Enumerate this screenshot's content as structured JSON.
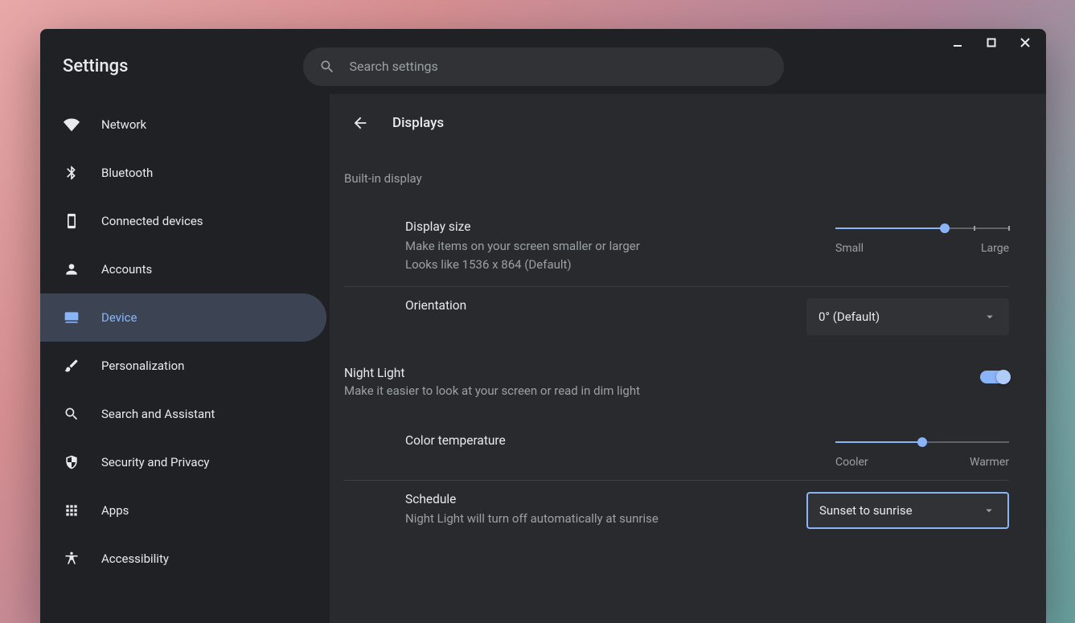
{
  "header": {
    "title": "Settings"
  },
  "search": {
    "placeholder": "Search settings"
  },
  "sidebar": {
    "items": [
      {
        "label": "Network",
        "icon": "wifi"
      },
      {
        "label": "Bluetooth",
        "icon": "bluetooth"
      },
      {
        "label": "Connected devices",
        "icon": "phone"
      },
      {
        "label": "Accounts",
        "icon": "person"
      },
      {
        "label": "Device",
        "icon": "laptop",
        "active": true
      },
      {
        "label": "Personalization",
        "icon": "brush"
      },
      {
        "label": "Search and Assistant",
        "icon": "search"
      },
      {
        "label": "Security and Privacy",
        "icon": "shield"
      },
      {
        "label": "Apps",
        "icon": "apps"
      },
      {
        "label": "Accessibility",
        "icon": "accessibility"
      }
    ]
  },
  "page": {
    "title": "Displays",
    "section1_label": "Built-in display",
    "display_size": {
      "title": "Display size",
      "sub1": "Make items on your screen smaller or larger",
      "sub2": "Looks like 1536 x 864 (Default)",
      "min_label": "Small",
      "max_label": "Large",
      "percent": 63
    },
    "orientation": {
      "title": "Orientation",
      "value": "0° (Default)"
    },
    "night_light": {
      "title": "Night Light",
      "sub": "Make it easier to look at your screen or read in dim light",
      "enabled": true
    },
    "color_temp": {
      "title": "Color temperature",
      "min_label": "Cooler",
      "max_label": "Warmer",
      "percent": 50
    },
    "schedule": {
      "title": "Schedule",
      "sub": "Night Light will turn off automatically at sunrise",
      "value": "Sunset to sunrise"
    }
  }
}
